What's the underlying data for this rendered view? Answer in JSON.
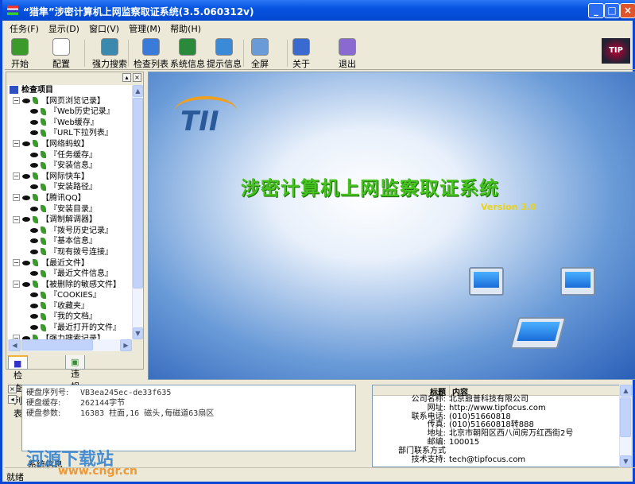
{
  "window": {
    "title": "“猎隼”涉密计算机上网监察取证系统(3.5.060312v)",
    "min": "_",
    "max": "□",
    "close": "×"
  },
  "menu": [
    "任务(F)",
    "显示(D)",
    "窗口(V)",
    "管理(M)",
    "帮助(H)"
  ],
  "toolbar": [
    {
      "label": "开始",
      "icon": "arrow-right-icon",
      "color": "#3a9a2a"
    },
    {
      "label": "配置",
      "icon": "hand-icon",
      "color": "#ffffff"
    },
    {
      "label": "强力搜索",
      "icon": "search-pc-icon",
      "color": "#3a8ab0"
    },
    {
      "label": "检查列表",
      "icon": "globe-check-icon",
      "color": "#3a7ad8"
    },
    {
      "label": "系统信息",
      "icon": "globe-icon",
      "color": "#2a8a3a"
    },
    {
      "label": "提示信息",
      "icon": "window-arrow-icon",
      "color": "#3a8ad8"
    },
    {
      "label": "全屏",
      "icon": "fullscreen-icon",
      "color": "#6a9ad8"
    },
    {
      "label": "关于",
      "icon": "help-icon",
      "color": "#3a6ad0"
    },
    {
      "label": "退出",
      "icon": "exit-door-icon",
      "color": "#8a6ad0"
    }
  ],
  "logo": "TIP",
  "tree": {
    "root": "检查项目",
    "nodes": [
      {
        "label": "【网页浏览记录】",
        "level": 0
      },
      {
        "label": "『Web历史记录』",
        "level": 1
      },
      {
        "label": "『Web缓存』",
        "level": 1
      },
      {
        "label": "『URL下拉列表』",
        "level": 1
      },
      {
        "label": "【网络蚂蚁】",
        "level": 0
      },
      {
        "label": "『任务缓存』",
        "level": 1
      },
      {
        "label": "『安装信息』",
        "level": 1
      },
      {
        "label": "【网际快车】",
        "level": 0
      },
      {
        "label": "『安装路径』",
        "level": 1
      },
      {
        "label": "【腾讯QQ】",
        "level": 0
      },
      {
        "label": "『安装目录』",
        "level": 1
      },
      {
        "label": "【调制解调器】",
        "level": 0
      },
      {
        "label": "『拨号历史记录』",
        "level": 1
      },
      {
        "label": "『基本信息』",
        "level": 1
      },
      {
        "label": "『现有拨号连接』",
        "level": 1
      },
      {
        "label": "【最近文件】",
        "level": 0
      },
      {
        "label": "『最近文件信息』",
        "level": 1
      },
      {
        "label": "【被删除的敏感文件】",
        "level": 0
      },
      {
        "label": "『COOKIES』",
        "level": 1
      },
      {
        "label": "『收藏夹』",
        "level": 1
      },
      {
        "label": "『我的文档』",
        "level": 1
      },
      {
        "label": "『最近打开的文件』",
        "level": 1
      },
      {
        "label": "【强力搜索记录】",
        "level": 0
      }
    ]
  },
  "left_tabs": [
    "检查列表",
    "违规人员"
  ],
  "splash": {
    "logo": "TII",
    "title": "涉密计算机上网监察取证系统",
    "version": "Version 3.0"
  },
  "disk_info": [
    {
      "key": "硬盘序列号:",
      "value": "VB3ea245ec-de33f635"
    },
    {
      "key": "硬盘缓存:",
      "value": "262144字节"
    },
    {
      "key": "硬盘参数:",
      "value": "16383 柱面,16 磁头,每磁道63扇区"
    }
  ],
  "bottom_tab": "系统信息",
  "info_list": {
    "headers": [
      "标题",
      "内容"
    ],
    "rows": [
      {
        "t": "公司名称:",
        "c": "北京鼎普科技有限公司"
      },
      {
        "t": "网址:",
        "c": "http://www.tipfocus.com"
      },
      {
        "t": "联系电话:",
        "c": "(010)51660818"
      },
      {
        "t": "传真:",
        "c": "(010)51660818转888"
      },
      {
        "t": "地址:",
        "c": "北京市朝阳区西八间房万红西街2号"
      },
      {
        "t": "邮编:",
        "c": "100015"
      },
      {
        "t": "部门联系方式",
        "c": ""
      },
      {
        "t": "技术支持:",
        "c": "tech@tipfocus.com"
      }
    ]
  },
  "status": "就绪",
  "watermark": {
    "name": "河源下载站",
    "url": "www.cngr.cn"
  }
}
